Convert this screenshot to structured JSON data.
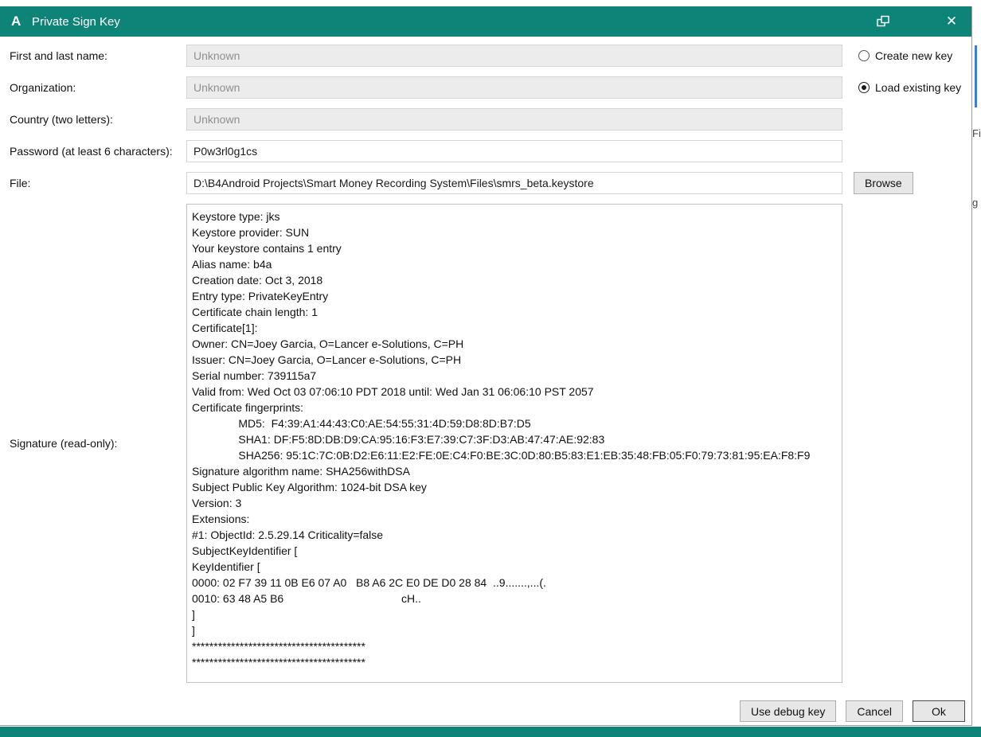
{
  "titlebar": {
    "logo": "A",
    "title": "Private Sign Key",
    "close_glyph": "✕"
  },
  "form": {
    "fields": [
      {
        "label": "First and last name:",
        "placeholder": "Unknown"
      },
      {
        "label": "Organization:",
        "placeholder": "Unknown"
      },
      {
        "label": "Country (two letters):",
        "placeholder": "Unknown"
      },
      {
        "label": "Password (at least 6 characters):",
        "value": "P0w3rl0g1cs"
      },
      {
        "label": "File:",
        "value": "D:\\B4Android Projects\\Smart Money Recording System\\Files\\smrs_beta.keystore"
      },
      {
        "label": "Signature (read-only):"
      }
    ],
    "browse_label": "Browse",
    "signature_text": "Keystore type: jks\nKeystore provider: SUN\nYour keystore contains 1 entry\nAlias name: b4a\nCreation date: Oct 3, 2018\nEntry type: PrivateKeyEntry\nCertificate chain length: 1\nCertificate[1]:\nOwner: CN=Joey Garcia, O=Lancer e-Solutions, C=PH\nIssuer: CN=Joey Garcia, O=Lancer e-Solutions, C=PH\nSerial number: 739115a7\nValid from: Wed Oct 03 07:06:10 PDT 2018 until: Wed Jan 31 06:06:10 PST 2057\nCertificate fingerprints:\n               MD5:  F4:39:A1:44:43:C0:AE:54:55:31:4D:59:D8:8D:B7:D5\n               SHA1: DF:F5:8D:DB:D9:CA:95:16:F3:E7:39:C7:3F:D3:AB:47:47:AE:92:83\n               SHA256: 95:1C:7C:0B:D2:E6:11:E2:FE:0E:C4:F0:BE:3C:0D:80:B5:83:E1:EB:35:48:FB:05:F0:79:73:81:95:EA:F8:F9\nSignature algorithm name: SHA256withDSA\nSubject Public Key Algorithm: 1024-bit DSA key\nVersion: 3\nExtensions:\n#1: ObjectId: 2.5.29.14 Criticality=false\nSubjectKeyIdentifier [\nKeyIdentifier [\n0000: 02 F7 39 11 0B E6 07 A0   B8 A6 2C E0 DE D0 28 84  ..9.......,...(.\n0010: 63 48 A5 B6                                      cH..\n]\n]\n****************************************\n****************************************"
  },
  "key_options": [
    {
      "label": "Create new key",
      "selected": false
    },
    {
      "label": "Load existing key",
      "selected": true
    }
  ],
  "footer": {
    "buttons": [
      "Use debug key",
      "Cancel",
      "Ok"
    ]
  },
  "background": {
    "fragments_right": [
      {
        "text": "Fil"
      },
      {
        "text": "g"
      }
    ],
    "colors": {
      "titlebar_teal": "#0e8479",
      "statusbar_teal": "#0e8479",
      "scrollbar_blue": "#3b7dd8"
    }
  }
}
